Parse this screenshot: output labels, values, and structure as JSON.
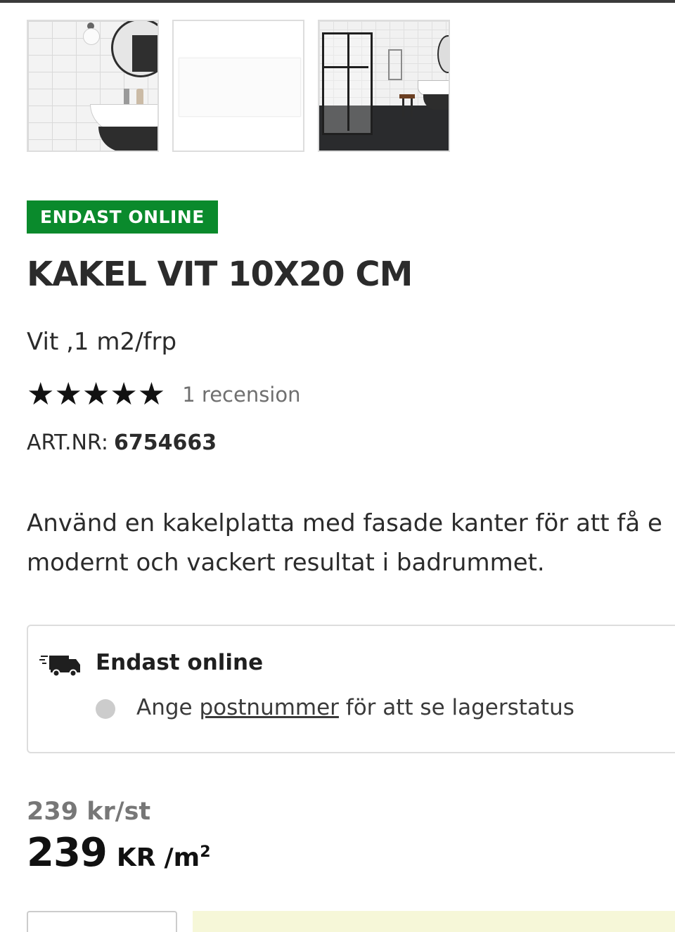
{
  "gallery": {
    "thumbnails": [
      {
        "name": "thumbnail-bathroom-mirror"
      },
      {
        "name": "thumbnail-tile"
      },
      {
        "name": "thumbnail-bathroom-shower"
      }
    ]
  },
  "product": {
    "badge": "ENDAST ONLINE",
    "title": "KAKEL VIT 10X20 CM",
    "subtitle": "Vit ,1 m2/frp",
    "rating": {
      "stars": "★★★★★",
      "value": 5,
      "max": 5,
      "review_count_text": "1 recension"
    },
    "art_nr_label": "ART.NR:",
    "art_nr": "6754663",
    "description_line1": "Använd en kakelplatta med fasade kanter för att få e",
    "description_line2": "modernt och vackert resultat i badrummet."
  },
  "stock": {
    "icon": "delivery-truck-icon",
    "title": "Endast online",
    "status_prefix": "Ange ",
    "status_link": "postnummer",
    "status_suffix": " för att se lagerstatus"
  },
  "price": {
    "unit_price": "239 kr/st",
    "amount": "239",
    "currency": "KR",
    "per": "/m",
    "per_sup": "2"
  },
  "colors": {
    "badge_green": "#0a8a2c",
    "text_dark": "#2b2b2b",
    "muted_gray": "#777777",
    "cart_yellow": "#f6f7d8"
  }
}
